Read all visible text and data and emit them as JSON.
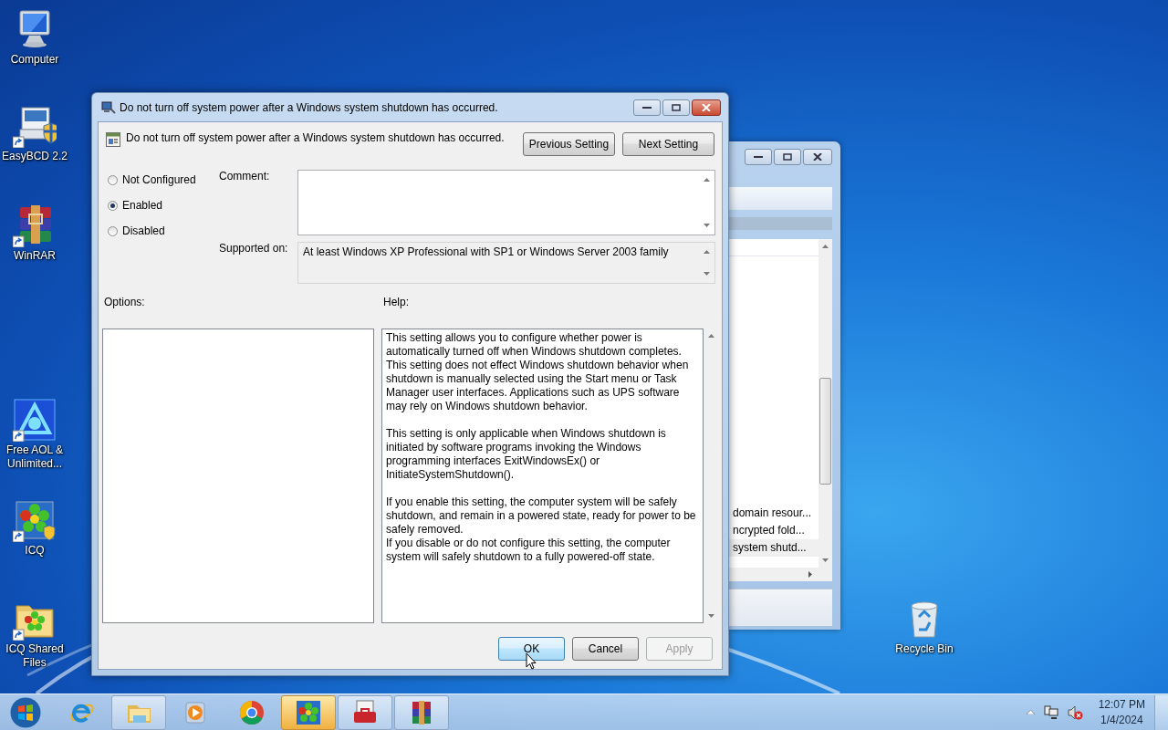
{
  "desktop_icons": [
    {
      "label": "Computer",
      "kind": "computer",
      "shortcut": false
    },
    {
      "label": "EasyBCD 2.2",
      "kind": "easybcd",
      "shortcut": true
    },
    {
      "label": "WinRAR",
      "kind": "winrar",
      "shortcut": true
    },
    {
      "label": "Free AOL & Unlimited...",
      "kind": "aol",
      "shortcut": true
    },
    {
      "label": "ICQ",
      "kind": "icq",
      "shortcut": true
    },
    {
      "label": "ICQ Shared Files",
      "kind": "folder",
      "shortcut": true
    },
    {
      "label": "Recycle Bin",
      "kind": "recycle",
      "shortcut": false
    }
  ],
  "background_window": {
    "rows": [
      {
        "label": "domain resour...",
        "selected": false
      },
      {
        "label": "ncrypted fold...",
        "selected": false
      },
      {
        "label": "system shutd...",
        "selected": true
      }
    ]
  },
  "dialog": {
    "title": "Do not turn off system power after a Windows system shutdown has occurred.",
    "setting_name": "Do not turn off system power after a Windows system shutdown has occurred.",
    "nav_buttons": [
      "Previous Setting",
      "Next Setting"
    ],
    "states": [
      {
        "label": "Not Configured",
        "selected": false
      },
      {
        "label": "Enabled",
        "selected": true
      },
      {
        "label": "Disabled",
        "selected": false
      }
    ],
    "comment_label": "Comment:",
    "supported_label": "Supported on:",
    "supported_value": "At least Windows XP Professional with SP1 or Windows Server 2003 family",
    "options_label": "Options:",
    "help_label": "Help:",
    "help_text": "This setting allows you to configure whether power is automatically turned off when Windows shutdown completes. This setting does not effect Windows shutdown behavior when shutdown is manually selected using the Start menu or Task Manager user interfaces.  Applications such as UPS software may rely on Windows shutdown behavior.\n\nThis setting is only applicable when Windows shutdown is initiated by software programs invoking the Windows programming interfaces ExitWindowsEx() or InitiateSystemShutdown().\n\nIf you enable this setting, the computer system will be safely shutdown, and remain in a powered state, ready for power to be safely removed.\nIf you disable or do not configure this setting, the computer system will safely shutdown to a fully powered-off state.",
    "buttons": [
      {
        "label": "OK",
        "focused": true,
        "disabled": false
      },
      {
        "label": "Cancel",
        "focused": false,
        "disabled": false
      },
      {
        "label": "Apply",
        "focused": false,
        "disabled": true
      }
    ]
  },
  "taskbar": {
    "items": [
      {
        "kind": "ie",
        "open": false,
        "active": false
      },
      {
        "kind": "explorer",
        "open": true,
        "active": false
      },
      {
        "kind": "media",
        "open": false,
        "active": false
      },
      {
        "kind": "chrome",
        "open": false,
        "active": false
      },
      {
        "kind": "icq",
        "open": true,
        "active": true
      },
      {
        "kind": "toolbox",
        "open": true,
        "active": false
      },
      {
        "kind": "winrar",
        "open": true,
        "active": false
      }
    ],
    "clock": {
      "time": "12:07 PM",
      "date": "1/4/2024"
    }
  }
}
